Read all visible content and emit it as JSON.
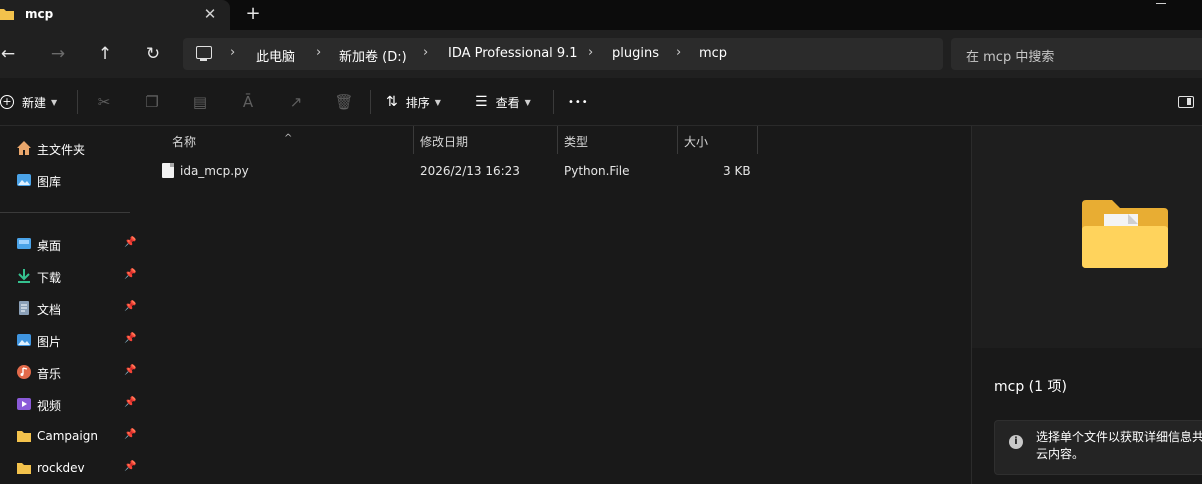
{
  "tab": {
    "title": "mcp",
    "close": "✕",
    "new": "+"
  },
  "nav": {
    "back": "←",
    "forward": "→",
    "up": "↑",
    "refresh": "↻"
  },
  "breadcrumb": [
    "此电脑",
    "新加卷 (D:)",
    "IDA Professional 9.1",
    "plugins",
    "mcp"
  ],
  "search": {
    "placeholder": "在 mcp 中搜索"
  },
  "toolbar": {
    "new_label": "新建",
    "sort_label": "排序",
    "view_label": "查看",
    "more": "•••"
  },
  "sidebar": {
    "pinned": [
      {
        "label": "主文件夹",
        "icon": "home-icon"
      },
      {
        "label": "图库",
        "icon": "gallery-icon"
      }
    ],
    "quick": [
      {
        "label": "桌面",
        "icon": "desktop-icon",
        "color": "#4aa3e8"
      },
      {
        "label": "下载",
        "icon": "download-icon",
        "color": "#35c18f"
      },
      {
        "label": "文档",
        "icon": "documents-icon",
        "color": "#8aa0b8"
      },
      {
        "label": "图片",
        "icon": "pictures-icon",
        "color": "#3f95e0"
      },
      {
        "label": "音乐",
        "icon": "music-icon",
        "color": "#e26a4a"
      },
      {
        "label": "视频",
        "icon": "videos-icon",
        "color": "#8a5ad8"
      },
      {
        "label": "Campaign",
        "icon": "folder-icon",
        "color": "#f3c24c"
      },
      {
        "label": "rockdev",
        "icon": "folder-icon",
        "color": "#f3c24c"
      }
    ]
  },
  "columns": [
    "名称",
    "修改日期",
    "类型",
    "大小"
  ],
  "files": [
    {
      "name": "ida_mcp.py",
      "modified": "2026/2/13 16:23",
      "type": "Python.File",
      "size": "3 KB"
    }
  ],
  "preview": {
    "title": "mcp (1 项)",
    "info": "选择单个文件以获取详细信息共享云内容。"
  },
  "colors": {
    "folder": "#f3c24c",
    "accent": "#4aa3e8"
  }
}
